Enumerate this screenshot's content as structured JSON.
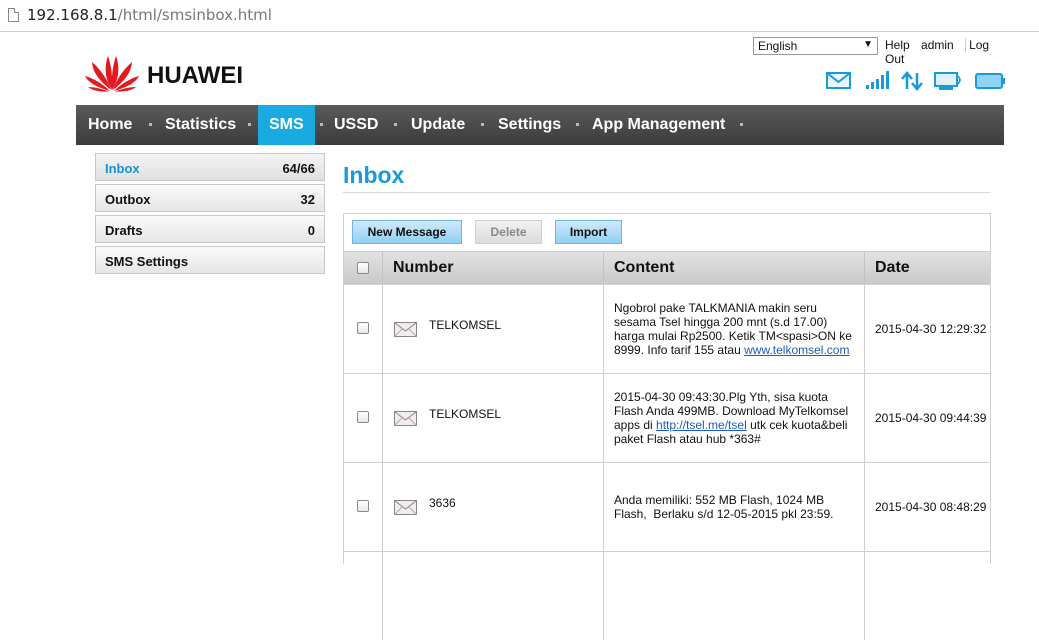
{
  "browser": {
    "url_host": "192.168.8.1",
    "url_path": "/html/smsinbox.html"
  },
  "header": {
    "brand": "HUAWEI",
    "language": "English",
    "help": "Help",
    "user": "admin",
    "logout": "Log Out",
    "status_icons": [
      "mail-icon",
      "signal-strength-icon",
      "data-transfer-icon",
      "connection-monitor-icon",
      "battery-icon"
    ],
    "accent_color": "#1aaae2"
  },
  "nav": {
    "items": [
      "Home",
      "Statistics",
      "SMS",
      "USSD",
      "Update",
      "Settings",
      "App Management"
    ],
    "active": "SMS"
  },
  "sidebar": {
    "items": [
      {
        "label": "Inbox",
        "count": "64/66"
      },
      {
        "label": "Outbox",
        "count": "32"
      },
      {
        "label": "Drafts",
        "count": "0"
      },
      {
        "label": "SMS Settings",
        "count": ""
      }
    ]
  },
  "main": {
    "title": "Inbox",
    "buttons": {
      "new": "New Message",
      "delete": "Delete",
      "import": "Import"
    },
    "columns": {
      "number": "Number",
      "content": "Content",
      "date": "Date"
    },
    "rows": [
      {
        "number": "TELKOMSEL",
        "content_lines": [
          "Ngobrol pake TALKMANIA makin seru",
          "sesama Tsel hingga 200 mnt (s.d 17.00)",
          "harga mulai Rp2500. Ketik TM<spasi>ON ke",
          "8999. Info tarif 155 atau "
        ],
        "content_link": "www.telkomsel.com",
        "date": "2015-04-30 12:29:32"
      },
      {
        "number": "TELKOMSEL",
        "content_lines": [
          "2015-04-30 09:43:30.Plg Yth, sisa kuota",
          "Flash Anda 499MB. Download MyTelkomsel",
          "apps di ",
          " utk cek kuota&beli",
          "paket Flash atau hub *363#"
        ],
        "content_link": "http://tsel.me/tsel",
        "date": "2015-04-30 09:44:39"
      },
      {
        "number": "3636",
        "content_lines": [
          "Anda memiliki: 552 MB Flash, 1024 MB",
          "Flash,  Berlaku s/d 12-05-2015 pkl 23:59."
        ],
        "date": "2015-04-30 08:48:29"
      }
    ]
  }
}
